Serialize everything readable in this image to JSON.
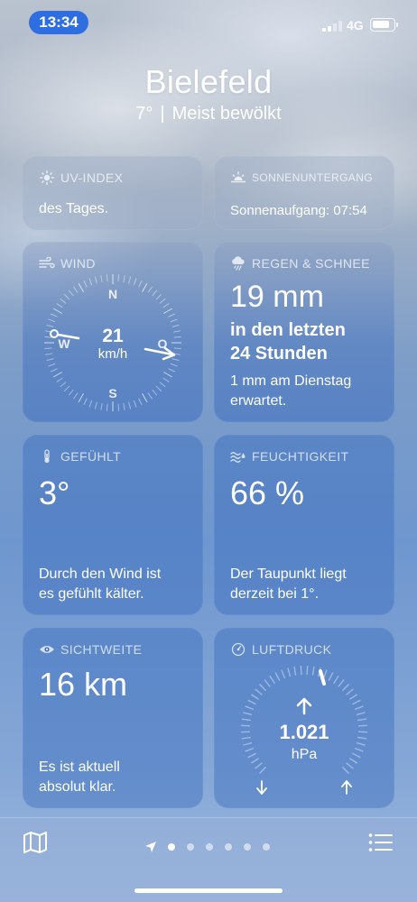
{
  "status": {
    "time": "13:34",
    "network": "4G",
    "battery_level": 0.85
  },
  "header": {
    "city": "Bielefeld",
    "temp": "7°",
    "separator": "|",
    "condition": "Meist bewölkt"
  },
  "uv": {
    "title": "UV-INDEX",
    "text": "des Tages."
  },
  "sun": {
    "title": "SONNENUNTERGANG",
    "text": "Sonnenaufgang: 07:54"
  },
  "wind": {
    "title": "WIND",
    "speed": "21",
    "unit": "km/h",
    "dir_n": "N",
    "dir_o": "O",
    "dir_s": "S",
    "dir_w": "W"
  },
  "rain": {
    "title": "REGEN & SCHNEE",
    "amount": "19 mm",
    "period_line1": "in den letzten",
    "period_line2": "24 Stunden",
    "forecast_line1": "1 mm am Dienstag",
    "forecast_line2": "erwartet."
  },
  "feels": {
    "title": "GEFÜHLT",
    "value": "3°",
    "text_line1": "Durch den Wind ist",
    "text_line2": "es gefühlt kälter."
  },
  "humidity": {
    "title": "FEUCHTIGKEIT",
    "value": "66 %",
    "text_line1": "Der Taupunkt liegt",
    "text_line2": "derzeit bei 1°."
  },
  "visibility": {
    "title": "SICHTWEITE",
    "value": "16 km",
    "text_line1": "Es ist aktuell",
    "text_line2": "absolut klar."
  },
  "pressure": {
    "title": "LUFTDRUCK",
    "value": "1.021",
    "unit": "hPa"
  },
  "bottom": {
    "page_count": 6,
    "current_page": 0
  },
  "icons": {
    "map": "map-icon",
    "location": "location-arrow-icon",
    "list": "list-icon",
    "sun": "sun-icon",
    "sunset": "sunset-icon",
    "wind": "wind-icon",
    "rain": "cloud-rain-icon",
    "thermometer": "thermometer-icon",
    "humidity": "humidity-icon",
    "eye": "eye-icon",
    "gauge": "gauge-icon"
  }
}
